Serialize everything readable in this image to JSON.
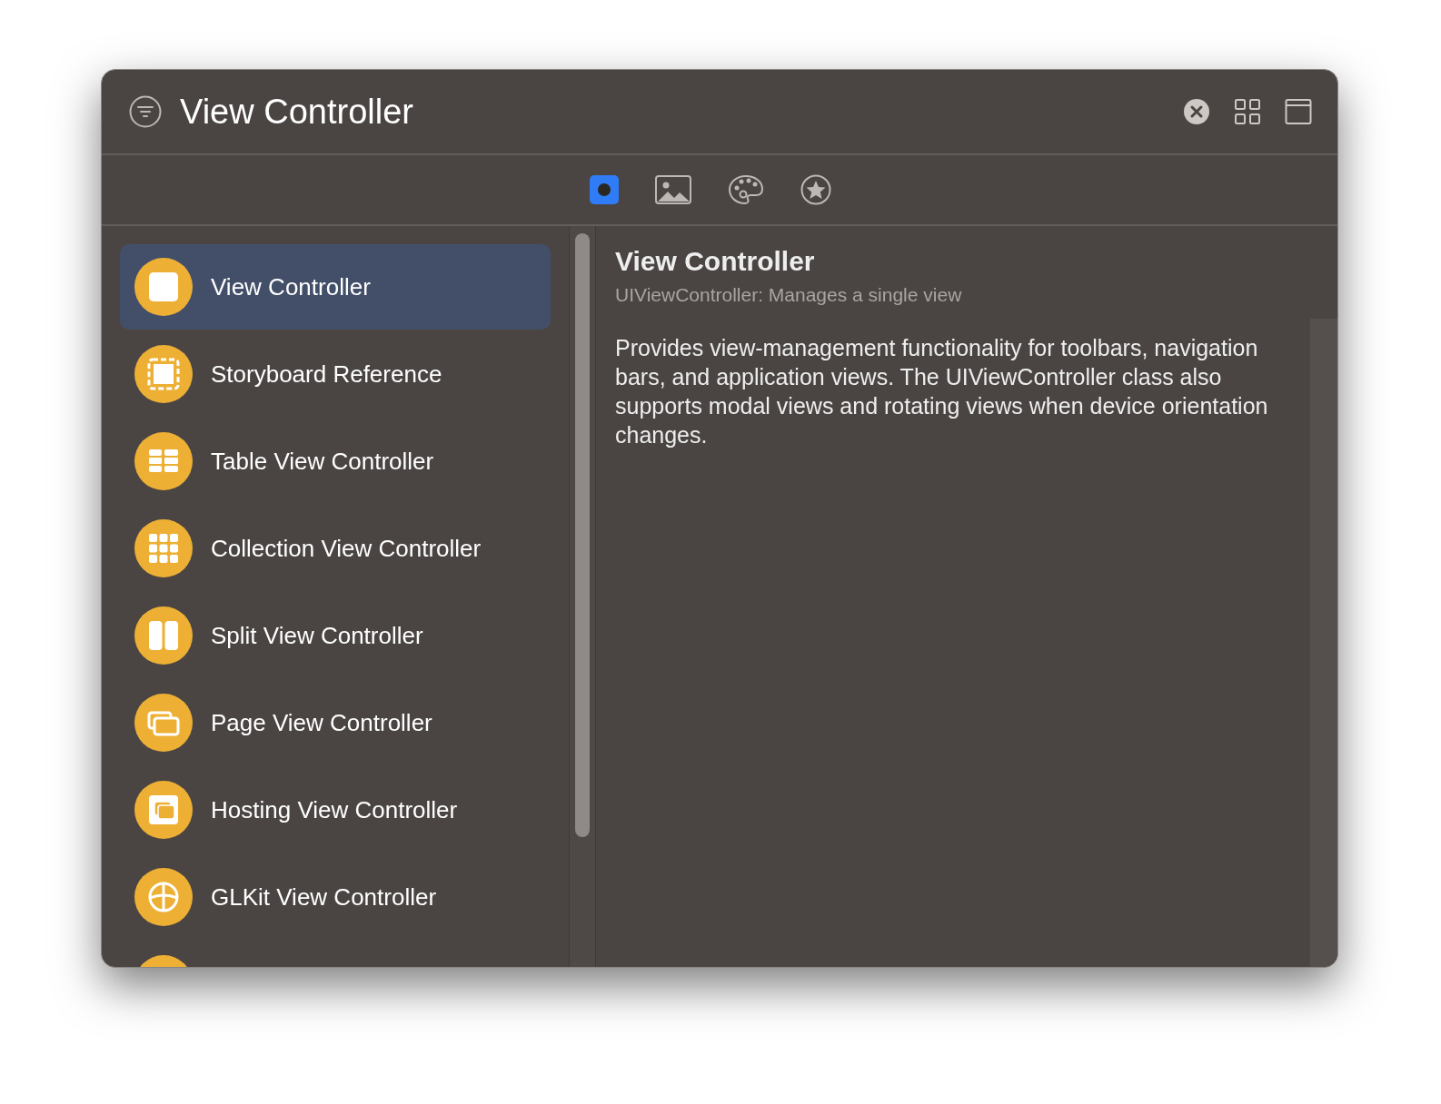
{
  "window": {
    "title": "View Controller"
  },
  "tabs": [
    {
      "kind": "object",
      "selected": true
    },
    {
      "kind": "image",
      "selected": false
    },
    {
      "kind": "palette",
      "selected": false
    },
    {
      "kind": "star",
      "selected": false
    }
  ],
  "library": {
    "items": [
      {
        "label": "View Controller",
        "kind": "square",
        "selected": true
      },
      {
        "label": "Storyboard Reference",
        "kind": "dashed",
        "selected": false
      },
      {
        "label": "Table View Controller",
        "kind": "table",
        "selected": false
      },
      {
        "label": "Collection View Controller",
        "kind": "grid",
        "selected": false
      },
      {
        "label": "Split View Controller",
        "kind": "split",
        "selected": false
      },
      {
        "label": "Page View Controller",
        "kind": "pages",
        "selected": false
      },
      {
        "label": "Hosting View Controller",
        "kind": "hosting",
        "selected": false
      },
      {
        "label": "GLKit View Controller",
        "kind": "globe",
        "selected": false
      },
      {
        "kind": "cut",
        "selected": false
      }
    ]
  },
  "detail": {
    "title": "View Controller",
    "subtitle": "UIViewController: Manages a single view",
    "description": "Provides view-management functionality for toolbars, navigation bars, and application views. The UIViewController class also supports modal views and rotating views when device orientation changes."
  }
}
